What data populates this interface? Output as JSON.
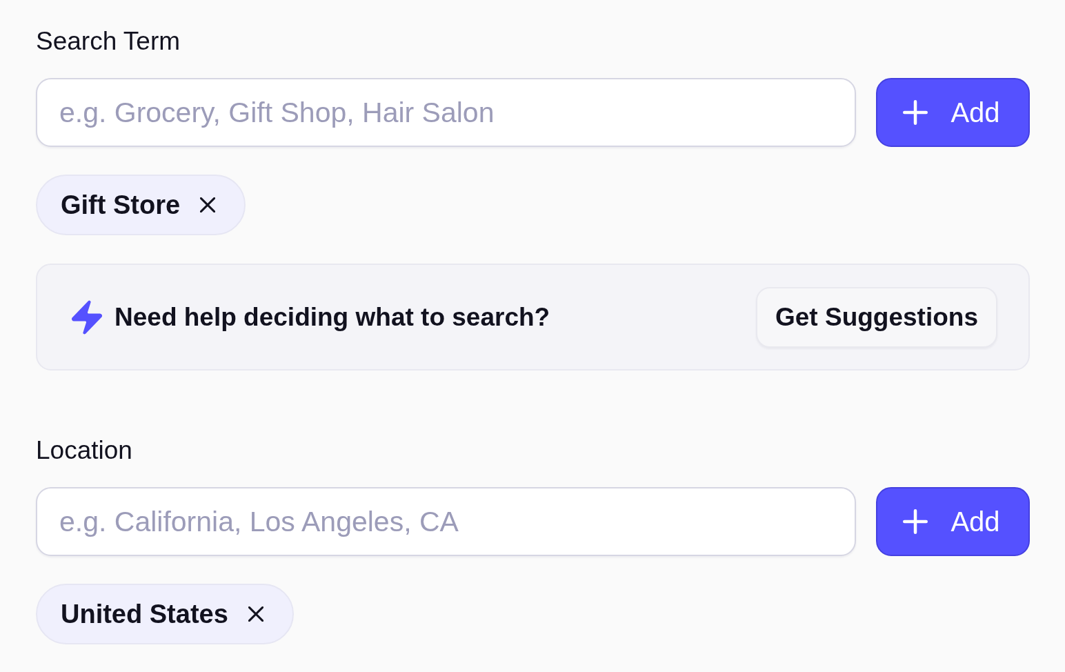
{
  "sections": [
    {
      "label": "Search Term",
      "input": {
        "placeholder": "e.g. Grocery, Gift Shop, Hair Salon"
      },
      "add_button": {
        "label": "Add"
      },
      "chips": [
        {
          "label": "Gift Store"
        }
      ],
      "help": {
        "text": "Need help deciding what to search?",
        "button": "Get Suggestions"
      }
    },
    {
      "label": "Location",
      "input": {
        "placeholder": "e.g. California, Los Angeles, CA"
      },
      "add_button": {
        "label": "Add"
      },
      "chips": [
        {
          "label": "United States"
        }
      ]
    }
  ]
}
